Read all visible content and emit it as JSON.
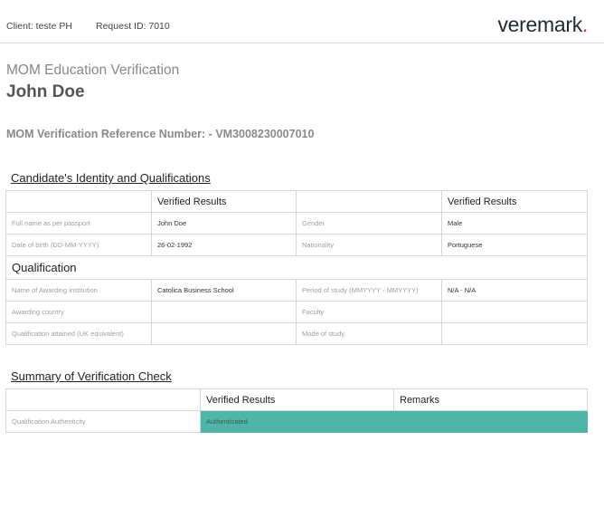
{
  "header": {
    "client": "Client: teste PH",
    "request_id": "Request ID: 7010",
    "logo_text": "veremark",
    "logo_dot": ".",
    "logo_dot_color": "#d6303a"
  },
  "document": {
    "title": "MOM Education Verification",
    "candidate_name": "John Doe",
    "reference_label": "MOM Verification Reference Number: -",
    "reference_value": "VM3008230007010"
  },
  "identity_section": {
    "heading": "Candidate's Identity and Qualifications",
    "column_header_left": "Verified Results",
    "column_header_right": "Verified Results",
    "rows": [
      {
        "label_left": "Full name as per passport",
        "value_left": "John Doe",
        "label_right": "Gender",
        "value_right": "Male"
      },
      {
        "label_left": "Date of birth (DD-MM-YYYY)",
        "value_left": "26-02-1992",
        "label_right": "Nationality",
        "value_right": "Portuguese"
      }
    ],
    "qualification_heading": "Qualification",
    "qualification_rows": [
      {
        "label_left": "Name of Awarding institution",
        "value_left": "Catolica Business School",
        "label_right": "Period of study (MMYYYY - MMYYYY)",
        "value_right": "N/A - N/A"
      },
      {
        "label_left": "Awarding country",
        "value_left": "",
        "label_right": "Faculty",
        "value_right": ""
      },
      {
        "label_left": "Qualification attained (UK equivalent)",
        "value_left": "",
        "label_right": "Mode of study",
        "value_right": ""
      }
    ]
  },
  "summary_section": {
    "heading": "Summary of Verification Check",
    "column_results": "Verified Results",
    "column_remarks": "Remarks",
    "row_label": "Qualification Authenticity",
    "row_value": "Authenticated",
    "status_color": "#4fb5a8"
  }
}
